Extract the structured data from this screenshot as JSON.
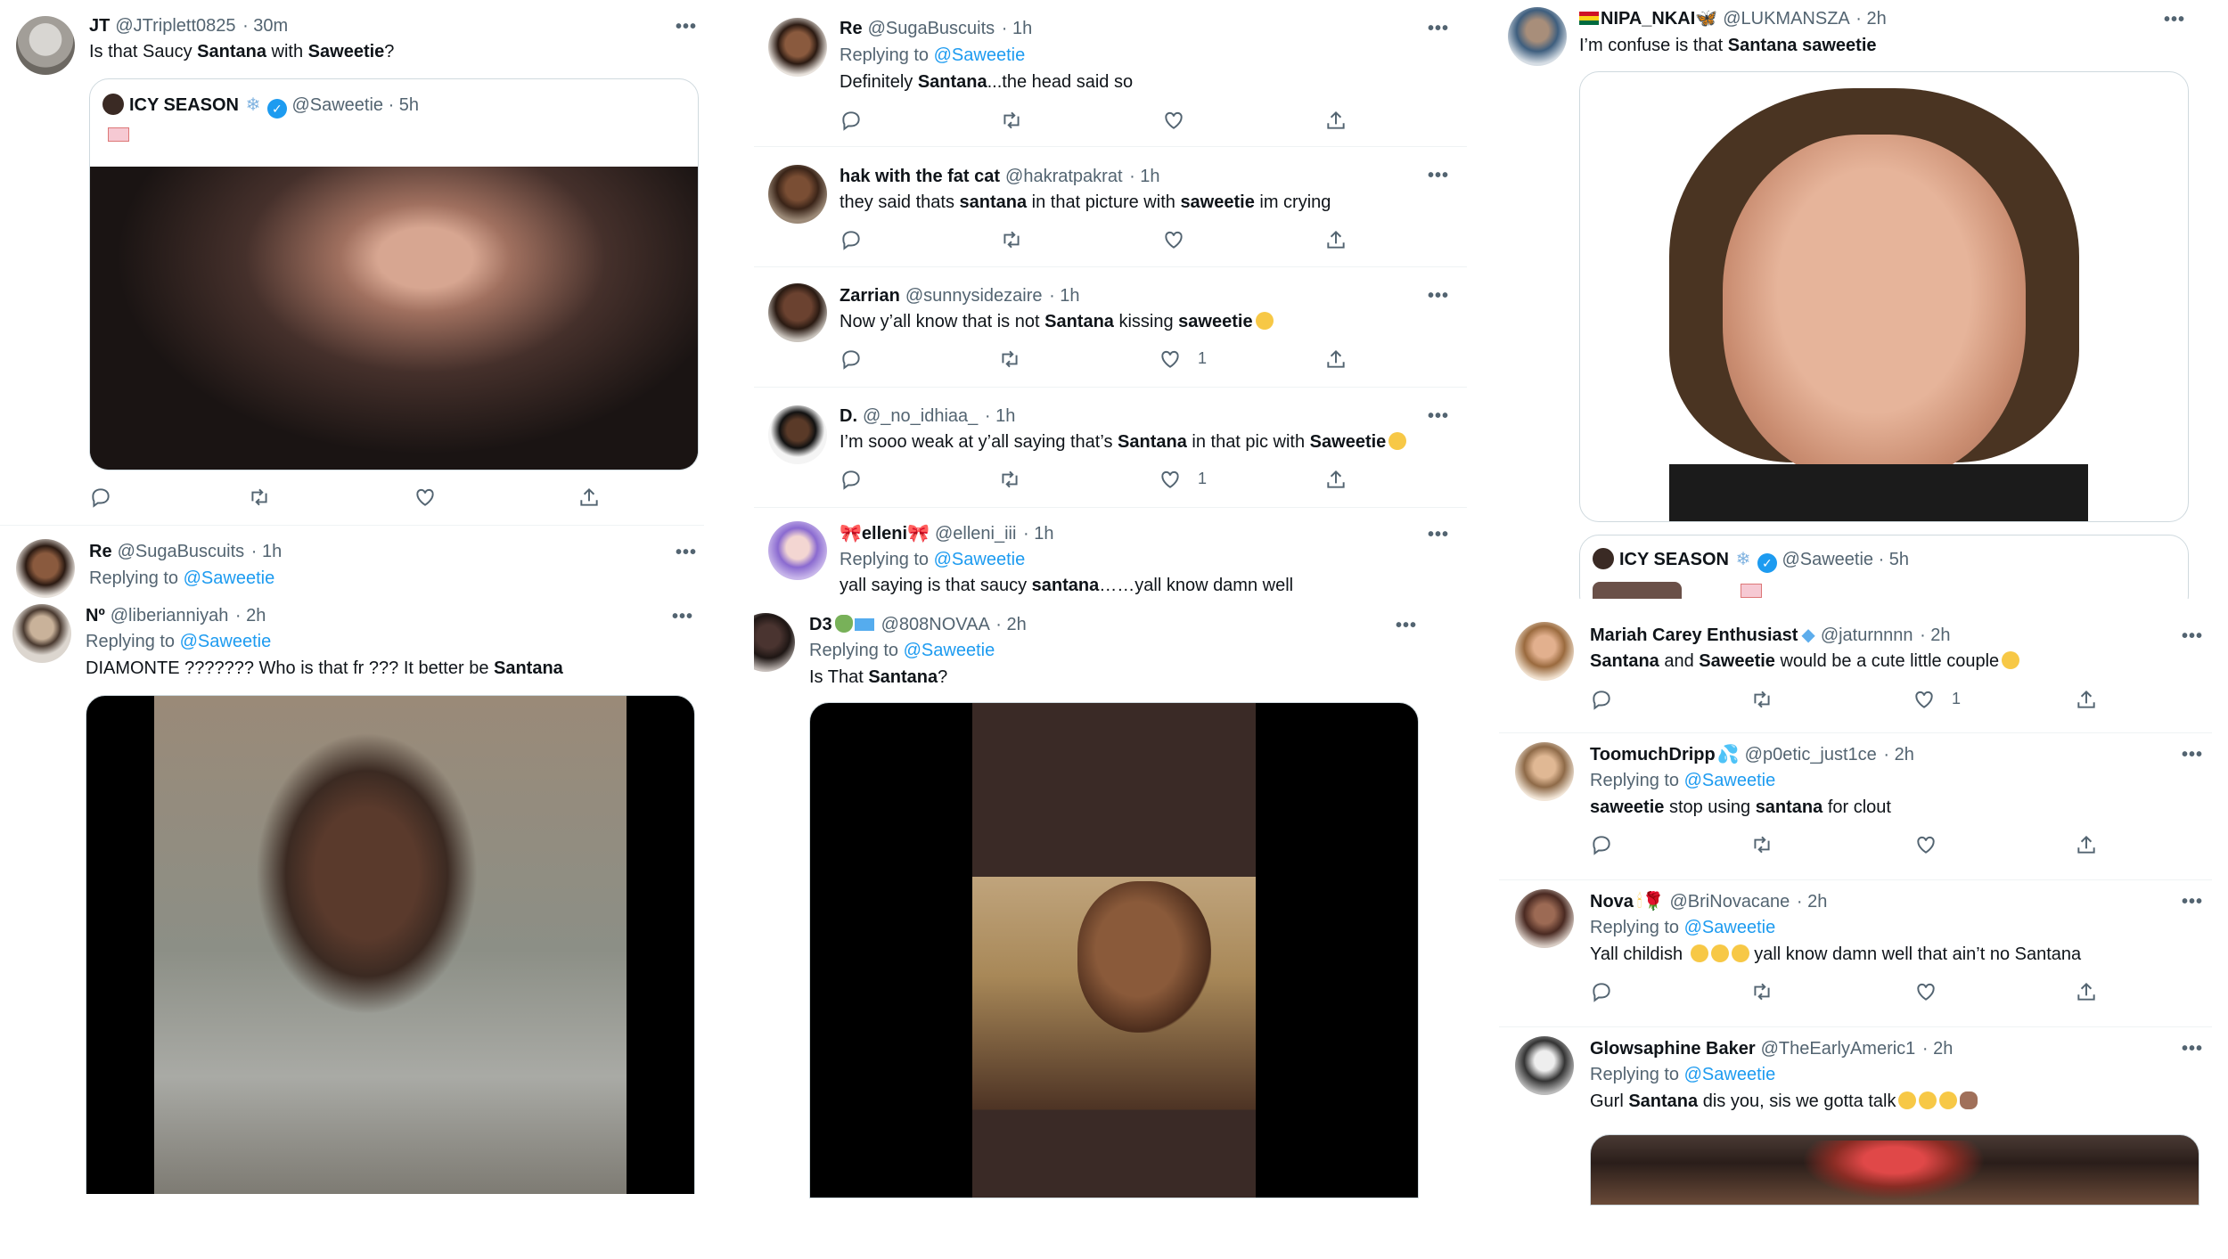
{
  "col1": {
    "t1": {
      "name": "JT",
      "handle": "@JTriplett0825",
      "time": "· 30m",
      "text_pre": "Is that Saucy ",
      "text_b1": "Santana",
      "text_mid": " with ",
      "text_b2": "Saweetie",
      "text_post": "?",
      "quote": {
        "name": "ICY SEASON",
        "handle": "@Saweetie",
        "time": "· 5h"
      }
    },
    "t2": {
      "name": "Re",
      "handle": "@SugaBuscuits",
      "time": "· 1h",
      "reply_label": "Replying to",
      "reply_to": "@Saweetie"
    },
    "t3": {
      "name": "Nº",
      "handle": "@liberianniyah",
      "time": "· 2h",
      "reply_label": "Replying to",
      "reply_to": "@Saweetie",
      "text_pre": "DIAMONTE ??????? Who is that fr ??? It better be ",
      "text_b1": "Santana"
    }
  },
  "col2": {
    "t1": {
      "name": "Re",
      "handle": "@SugaBuscuits",
      "time": "· 1h",
      "reply_label": "Replying to",
      "reply_to": "@Saweetie",
      "text_pre": "Definitely ",
      "text_b1": "Santana",
      "text_post": "...the head said so"
    },
    "t2": {
      "name": "hak with the fat cat",
      "handle": "@hakratpakrat",
      "time": "· 1h",
      "text_pre": "they said thats ",
      "text_b1": "santana",
      "text_mid": " in that picture with ",
      "text_b2": "saweetie",
      "text_post": " im crying"
    },
    "t3": {
      "name": "Zarrian",
      "handle": "@sunnysidezaire",
      "time": "· 1h",
      "text_pre": "Now y’all know that is not ",
      "text_b1": "Santana",
      "text_mid": " kissing ",
      "text_b2": "saweetie",
      "like_count": "1"
    },
    "t4": {
      "name": "D.",
      "handle": "@_no_idhiaa_",
      "time": "· 1h",
      "text_pre": "I’m sooo weak at y’all saying that’s ",
      "text_b1": "Santana",
      "text_mid": " in that pic with ",
      "text_b2": "Saweetie",
      "like_count": "1"
    },
    "t5": {
      "name": "elleni",
      "handle": "@elleni_iii",
      "time": "· 1h",
      "reply_label": "Replying to",
      "reply_to": "@Saweetie",
      "text_pre": "yall saying is that saucy ",
      "text_b1": "santana",
      "text_post": "……yall know damn well"
    },
    "t6": {
      "name": "D3",
      "handle": "@808NOVAA",
      "time": "· 2h",
      "reply_label": "Replying to",
      "reply_to": "@Saweetie",
      "text_pre": "Is That ",
      "text_b1": "Santana",
      "text_post": "?"
    }
  },
  "col3": {
    "t1": {
      "name": "NIPA_NKAI",
      "handle": "@LUKMANSZA",
      "time": "· 2h",
      "text_pre": "I’m confuse is that ",
      "text_b1": "Santana saweetie",
      "quote": {
        "name": "ICY SEASON",
        "handle": "@Saweetie",
        "time": "· 5h"
      }
    }
  },
  "col4": {
    "t1": {
      "name": "Mariah Carey Enthusiast",
      "handle": "@jaturnnnn",
      "time": "· 2h",
      "text_b1": "Santana",
      "text_mid": " and ",
      "text_b2": "Saweetie",
      "text_post": " would be a cute little couple",
      "like_count": "1"
    },
    "t2": {
      "name": "ToomuchDripp",
      "handle": "@p0etic_just1ce",
      "time": "· 2h",
      "reply_label": "Replying to",
      "reply_to": "@Saweetie",
      "text_b1": "saweetie",
      "text_mid": " stop using ",
      "text_b2": "santana",
      "text_post": " for clout"
    },
    "t3": {
      "name": "Nova",
      "handle": "@BriNovacane",
      "time": "· 2h",
      "reply_label": "Replying to",
      "reply_to": "@Saweetie",
      "text_pre": "Yall childish ",
      "text_post": " yall know damn well that ain’t no Santana"
    },
    "t4": {
      "name": "Glowsaphine Baker",
      "handle": "@TheEarlyAmeric1",
      "time": "· 2h",
      "reply_label": "Replying to",
      "reply_to": "@Saweetie",
      "text_pre": "Gurl ",
      "text_b1": "Santana",
      "text_post": " dis you, sis we gotta talk"
    }
  },
  "colors": {
    "accent": "#1d9bf0",
    "muted": "#536471",
    "text": "#0f1419",
    "border": "#cfd9de",
    "verified": "#1d9bf0"
  },
  "icons": [
    "reply-icon",
    "retweet-icon",
    "like-icon",
    "share-icon",
    "more-icon",
    "verified-icon",
    "snowflake-icon"
  ],
  "more_label": "•••"
}
